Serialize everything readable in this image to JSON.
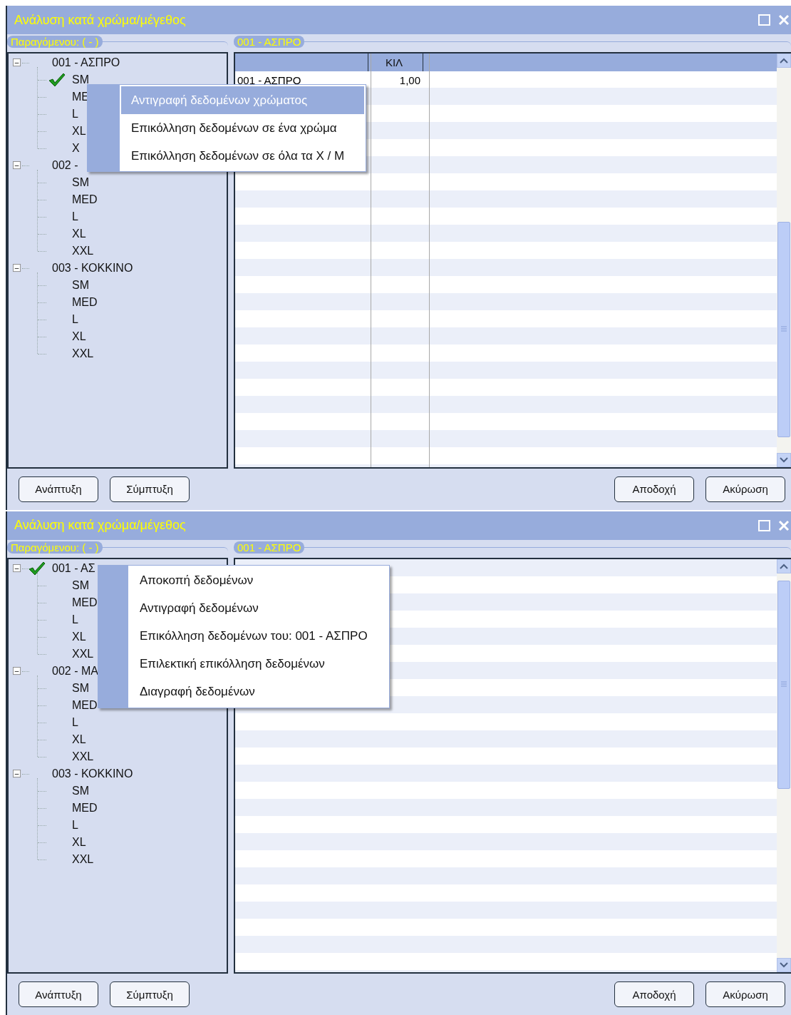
{
  "windows": [
    {
      "title": "Ανάλυση κατά χρώμα/μέγεθος",
      "tree_label": "Παραγόμενου:  ( - )",
      "grid_label": "001 - ΑΣΠΡΟ",
      "tree": [
        {
          "label": "001 - ΑΣΠΡΟ",
          "expanded": true,
          "checked": false,
          "children": [
            {
              "label": "SM",
              "checked": true
            },
            {
              "label": "ME",
              "checked": false
            },
            {
              "label": "L",
              "checked": false
            },
            {
              "label": "XL",
              "checked": false
            },
            {
              "label": "X",
              "checked": false
            }
          ]
        },
        {
          "label": "002 -",
          "expanded": true,
          "checked": false,
          "children": [
            {
              "label": "SM",
              "checked": false
            },
            {
              "label": "MED",
              "checked": false
            },
            {
              "label": "L",
              "checked": false
            },
            {
              "label": "XL",
              "checked": false
            },
            {
              "label": "XXL",
              "checked": false
            }
          ]
        },
        {
          "label": "003 - ΚΟΚΚΙΝΟ",
          "expanded": true,
          "checked": false,
          "children": [
            {
              "label": "SM",
              "checked": false
            },
            {
              "label": "MED",
              "checked": false
            },
            {
              "label": "L",
              "checked": false
            },
            {
              "label": "XL",
              "checked": false
            },
            {
              "label": "XXL",
              "checked": false
            }
          ]
        }
      ],
      "grid": {
        "columns": [
          "",
          "ΚΙΛ",
          ""
        ],
        "rows": [
          [
            "001 - ΑΣΠΡΟ",
            "1,00",
            ""
          ]
        ]
      },
      "context_menu": [
        {
          "label": "Αντιγραφή δεδομένων χρώματος",
          "selected": true
        },
        {
          "label": "Επικόλληση δεδομένων σε ένα χρώμα",
          "selected": false
        },
        {
          "label": "Επικόλληση δεδομένων σε όλα τα  Χ / Μ",
          "selected": false
        }
      ],
      "buttons_left": [
        "Ανάπτυξη",
        "Σύμπτυξη"
      ],
      "buttons_right": [
        "Αποδοχή",
        "Ακύρωση"
      ]
    },
    {
      "title": "Ανάλυση κατά χρώμα/μέγεθος",
      "tree_label": "Παραγόμενου:  ( - )",
      "grid_label": "001 - ΑΣΠΡΟ",
      "tree": [
        {
          "label": "001 - ΑΣ",
          "expanded": true,
          "checked": true,
          "children": [
            {
              "label": "SM",
              "checked": false
            },
            {
              "label": "MED",
              "checked": false
            },
            {
              "label": "L",
              "checked": false
            },
            {
              "label": "XL",
              "checked": false
            },
            {
              "label": "XXL",
              "checked": false
            }
          ]
        },
        {
          "label": "002 - MA",
          "expanded": true,
          "checked": false,
          "children": [
            {
              "label": "SM",
              "checked": false
            },
            {
              "label": "MED",
              "checked": false
            },
            {
              "label": "L",
              "checked": false
            },
            {
              "label": "XL",
              "checked": false
            },
            {
              "label": "XXL",
              "checked": false
            }
          ]
        },
        {
          "label": "003 - ΚΟΚΚΙΝΟ",
          "expanded": true,
          "checked": false,
          "children": [
            {
              "label": "SM",
              "checked": false
            },
            {
              "label": "MED",
              "checked": false
            },
            {
              "label": "L",
              "checked": false
            },
            {
              "label": "XL",
              "checked": false
            },
            {
              "label": "XXL",
              "checked": false
            }
          ]
        }
      ],
      "context_menu": [
        {
          "label": "Αποκοπή δεδομένων",
          "selected": false
        },
        {
          "label": "Αντιγραφή δεδομένων",
          "selected": false
        },
        {
          "label": "Επικόλληση δεδομένων του: 001 - ΑΣΠΡΟ",
          "selected": false
        },
        {
          "label": "Επιλεκτική επικόλληση δεδομένων",
          "selected": false
        },
        {
          "label": "Διαγραφή δεδομένων",
          "selected": false
        }
      ],
      "buttons_left": [
        "Ανάπτυξη",
        "Σύμπτυξη"
      ],
      "buttons_right": [
        "Αποδοχή",
        "Ακύρωση"
      ]
    }
  ]
}
